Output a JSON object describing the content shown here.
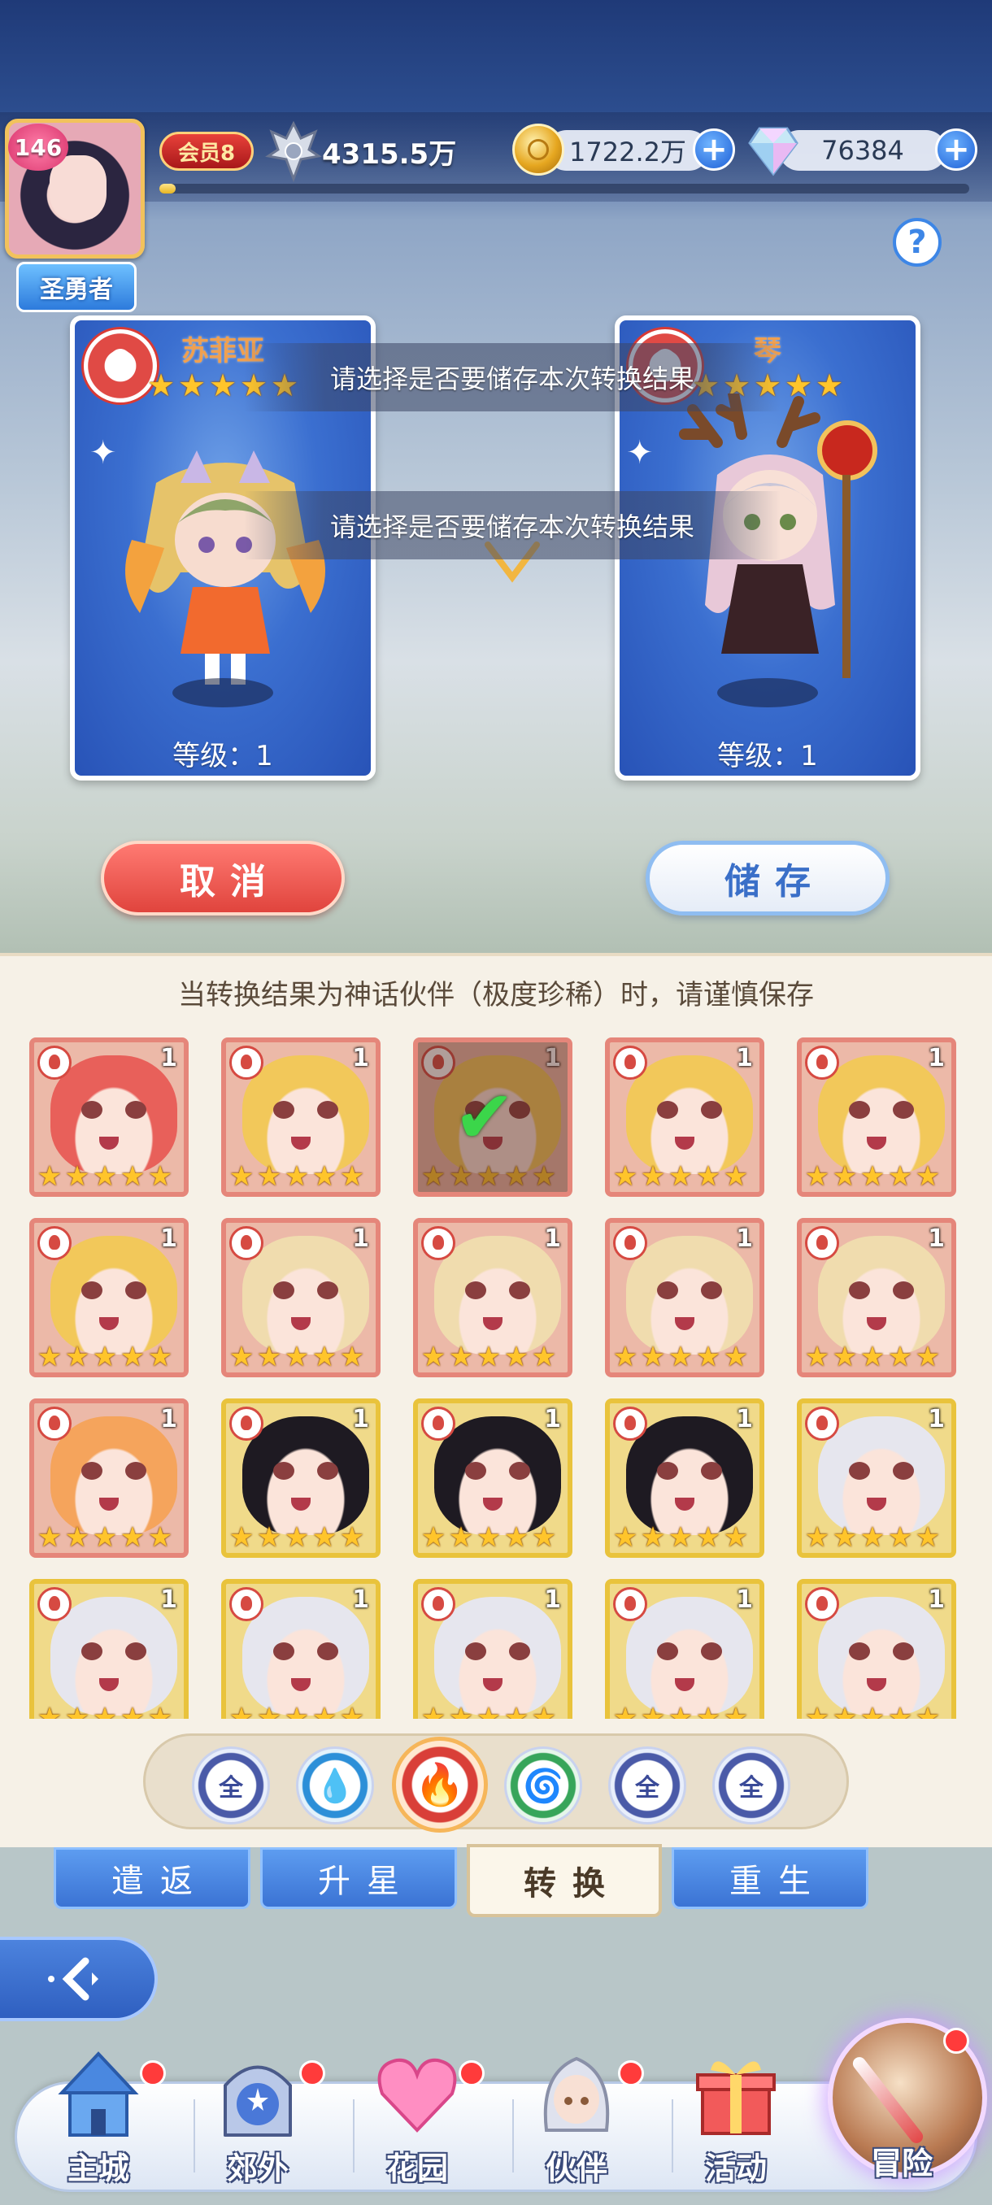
{
  "player": {
    "level": "146",
    "title": "圣勇者",
    "vip": "会员8",
    "power": "4315.5万",
    "gold": "1722.2万",
    "gems": "76384",
    "exp_progress": 0.02
  },
  "help_label": "?",
  "result_cards": [
    {
      "name": "苏菲亚",
      "stars": 5,
      "level_label": "等级：1",
      "element": "fire"
    },
    {
      "name": "琴",
      "stars": 5,
      "level_label": "等级：1",
      "element": "fire"
    }
  ],
  "notices": [
    "请选择是否要储存本次转换结果",
    "请选择是否要储存本次转换结果"
  ],
  "buttons": {
    "cancel": "取消",
    "save": "储存"
  },
  "panel": {
    "hint": "当转换结果为神话伙伴（极度珍稀）时，请谨慎保存"
  },
  "partners": [
    {
      "level": "1",
      "stars": 5,
      "rarity": "red",
      "hair": "#e8605a",
      "selected": false
    },
    {
      "level": "1",
      "stars": 5,
      "rarity": "red",
      "hair": "#f2c85a",
      "selected": false
    },
    {
      "level": "1",
      "stars": 5,
      "rarity": "red",
      "hair": "#f2c85a",
      "selected": true
    },
    {
      "level": "1",
      "stars": 5,
      "rarity": "red",
      "hair": "#f2c85a",
      "selected": false
    },
    {
      "level": "1",
      "stars": 5,
      "rarity": "red",
      "hair": "#f2c85a",
      "selected": false
    },
    {
      "level": "1",
      "stars": 5,
      "rarity": "red",
      "hair": "#f2c85a",
      "selected": false
    },
    {
      "level": "1",
      "stars": 5,
      "rarity": "red",
      "hair": "#f0dcae",
      "selected": false
    },
    {
      "level": "1",
      "stars": 5,
      "rarity": "red",
      "hair": "#f0dcae",
      "selected": false
    },
    {
      "level": "1",
      "stars": 5,
      "rarity": "red",
      "hair": "#f0dcae",
      "selected": false
    },
    {
      "level": "1",
      "stars": 5,
      "rarity": "red",
      "hair": "#f0dcae",
      "selected": false
    },
    {
      "level": "1",
      "stars": 5,
      "rarity": "red",
      "hair": "#f5a45c",
      "selected": false
    },
    {
      "level": "1",
      "stars": 5,
      "rarity": "gold",
      "hair": "#1e1a22",
      "selected": false
    },
    {
      "level": "1",
      "stars": 5,
      "rarity": "gold",
      "hair": "#1e1a22",
      "selected": false
    },
    {
      "level": "1",
      "stars": 5,
      "rarity": "gold",
      "hair": "#1e1a22",
      "selected": false
    },
    {
      "level": "1",
      "stars": 5,
      "rarity": "gold",
      "hair": "#e6e6ee",
      "selected": false
    },
    {
      "level": "1",
      "stars": 5,
      "rarity": "gold",
      "hair": "#e6e6ee",
      "selected": false
    },
    {
      "level": "1",
      "stars": 5,
      "rarity": "gold",
      "hair": "#e6e6ee",
      "selected": false
    },
    {
      "level": "1",
      "stars": 5,
      "rarity": "gold",
      "hair": "#e6e6ee",
      "selected": false
    },
    {
      "level": "1",
      "stars": 5,
      "rarity": "gold",
      "hair": "#e6e6ee",
      "selected": false
    },
    {
      "level": "1",
      "stars": 5,
      "rarity": "gold",
      "hair": "#e6e6ee",
      "selected": false
    }
  ],
  "element_filters": [
    {
      "label": "全",
      "type": "all-1"
    },
    {
      "label": "💧",
      "type": "water"
    },
    {
      "label": "🔥",
      "type": "fire",
      "active": true
    },
    {
      "label": "🌀",
      "type": "wind"
    },
    {
      "label": "全",
      "type": "all-2"
    },
    {
      "label": "全",
      "type": "all-3"
    }
  ],
  "tabs": [
    {
      "label": "遣返",
      "active": false
    },
    {
      "label": "升星",
      "active": false
    },
    {
      "label": "转换",
      "active": true
    },
    {
      "label": "重生",
      "active": false
    }
  ],
  "side_toggle_icon": "collapse-arrow-icon",
  "nav": [
    {
      "label": "主城",
      "icon": "castle-icon",
      "dot": true
    },
    {
      "label": "郊外",
      "icon": "portal-icon",
      "dot": true
    },
    {
      "label": "花园",
      "icon": "heart-icon",
      "dot": true
    },
    {
      "label": "伙伴",
      "icon": "partner-icon",
      "dot": true
    },
    {
      "label": "活动",
      "icon": "gift-icon",
      "dot": false
    },
    {
      "label": "冒险",
      "icon": "compass-icon",
      "dot": true
    }
  ],
  "colors": {
    "accent_blue": "#3b73d4",
    "fire_red": "#d93f38",
    "star_gold": "#ffc52b",
    "panel_bg": "#f6f1e7"
  }
}
